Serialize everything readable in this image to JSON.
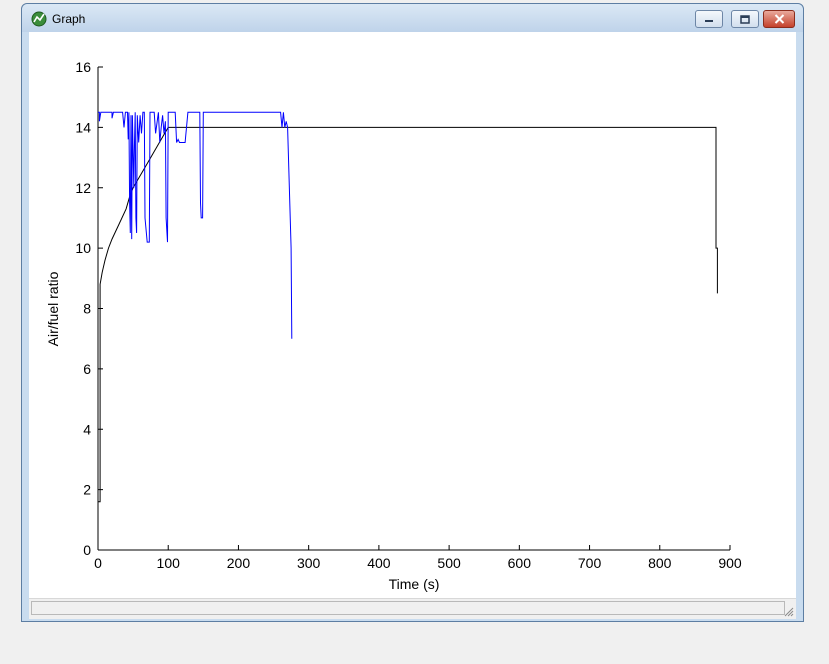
{
  "window": {
    "title": "Graph",
    "icons": {
      "app": "graph-app-icon",
      "minimize": "minimize-icon",
      "maximize": "maximize-icon",
      "close": "close-icon",
      "grip": "resize-grip-icon"
    },
    "status_text": ""
  },
  "chart_data": {
    "type": "line",
    "title": "",
    "xlabel": "Time (s)",
    "ylabel": "Air/fuel ratio",
    "xlim": [
      0,
      900
    ],
    "ylim": [
      0,
      16
    ],
    "xticks": [
      0,
      100,
      200,
      300,
      400,
      500,
      600,
      700,
      800,
      900
    ],
    "yticks": [
      0,
      2,
      4,
      6,
      8,
      10,
      12,
      14,
      16
    ],
    "grid": false,
    "legend": "none",
    "series": [
      {
        "color": "#000000",
        "points": [
          [
            0,
            0
          ],
          [
            0,
            1.6
          ],
          [
            3,
            1.6
          ],
          [
            3,
            8.8
          ],
          [
            6,
            9.2
          ],
          [
            10,
            9.6
          ],
          [
            15,
            10.0
          ],
          [
            20,
            10.3
          ],
          [
            30,
            10.8
          ],
          [
            40,
            11.3
          ],
          [
            45,
            11.7
          ],
          [
            50,
            12.0
          ],
          [
            60,
            12.4
          ],
          [
            70,
            12.8
          ],
          [
            80,
            13.2
          ],
          [
            90,
            13.6
          ],
          [
            95,
            13.8
          ],
          [
            100,
            14.0
          ],
          [
            880,
            14.0
          ],
          [
            880,
            10.0
          ],
          [
            882,
            10.0
          ],
          [
            882,
            8.5
          ]
        ]
      },
      {
        "color": "#0000ff",
        "points": [
          [
            0,
            14.5
          ],
          [
            2,
            14.5
          ],
          [
            2,
            14.2
          ],
          [
            4,
            14.5
          ],
          [
            20,
            14.5
          ],
          [
            20,
            14.3
          ],
          [
            22,
            14.5
          ],
          [
            35,
            14.5
          ],
          [
            37,
            14.0
          ],
          [
            39,
            14.5
          ],
          [
            42,
            14.5
          ],
          [
            43,
            13.6
          ],
          [
            44,
            14.5
          ],
          [
            45,
            11.5
          ],
          [
            46,
            10.5
          ],
          [
            47,
            14.4
          ],
          [
            48,
            10.3
          ],
          [
            49,
            14.4
          ],
          [
            51,
            12.0
          ],
          [
            52,
            13.5
          ],
          [
            53,
            14.5
          ],
          [
            54,
            11.0
          ],
          [
            55,
            10.5
          ],
          [
            56,
            14.4
          ],
          [
            58,
            13.5
          ],
          [
            60,
            14.4
          ],
          [
            62,
            13.8
          ],
          [
            64,
            14.5
          ],
          [
            66,
            14.5
          ],
          [
            67,
            11.0
          ],
          [
            70,
            10.2
          ],
          [
            73,
            10.2
          ],
          [
            74,
            14.5
          ],
          [
            80,
            14.5
          ],
          [
            82,
            13.8
          ],
          [
            86,
            14.5
          ],
          [
            88,
            13.5
          ],
          [
            90,
            14.0
          ],
          [
            92,
            14.4
          ],
          [
            94,
            13.8
          ],
          [
            96,
            14.2
          ],
          [
            97,
            11.0
          ],
          [
            99,
            10.2
          ],
          [
            100,
            14.5
          ],
          [
            110,
            14.5
          ],
          [
            112,
            13.5
          ],
          [
            114,
            13.6
          ],
          [
            116,
            13.5
          ],
          [
            124,
            13.5
          ],
          [
            126,
            14.0
          ],
          [
            128,
            14.5
          ],
          [
            145,
            14.5
          ],
          [
            146,
            11.5
          ],
          [
            147,
            11.0
          ],
          [
            149,
            11.0
          ],
          [
            150,
            14.5
          ],
          [
            260,
            14.5
          ],
          [
            262,
            14.0
          ],
          [
            264,
            14.5
          ],
          [
            266,
            14.0
          ],
          [
            268,
            14.2
          ],
          [
            270,
            14.0
          ],
          [
            275,
            10.0
          ],
          [
            276,
            7.0
          ]
        ]
      }
    ]
  }
}
